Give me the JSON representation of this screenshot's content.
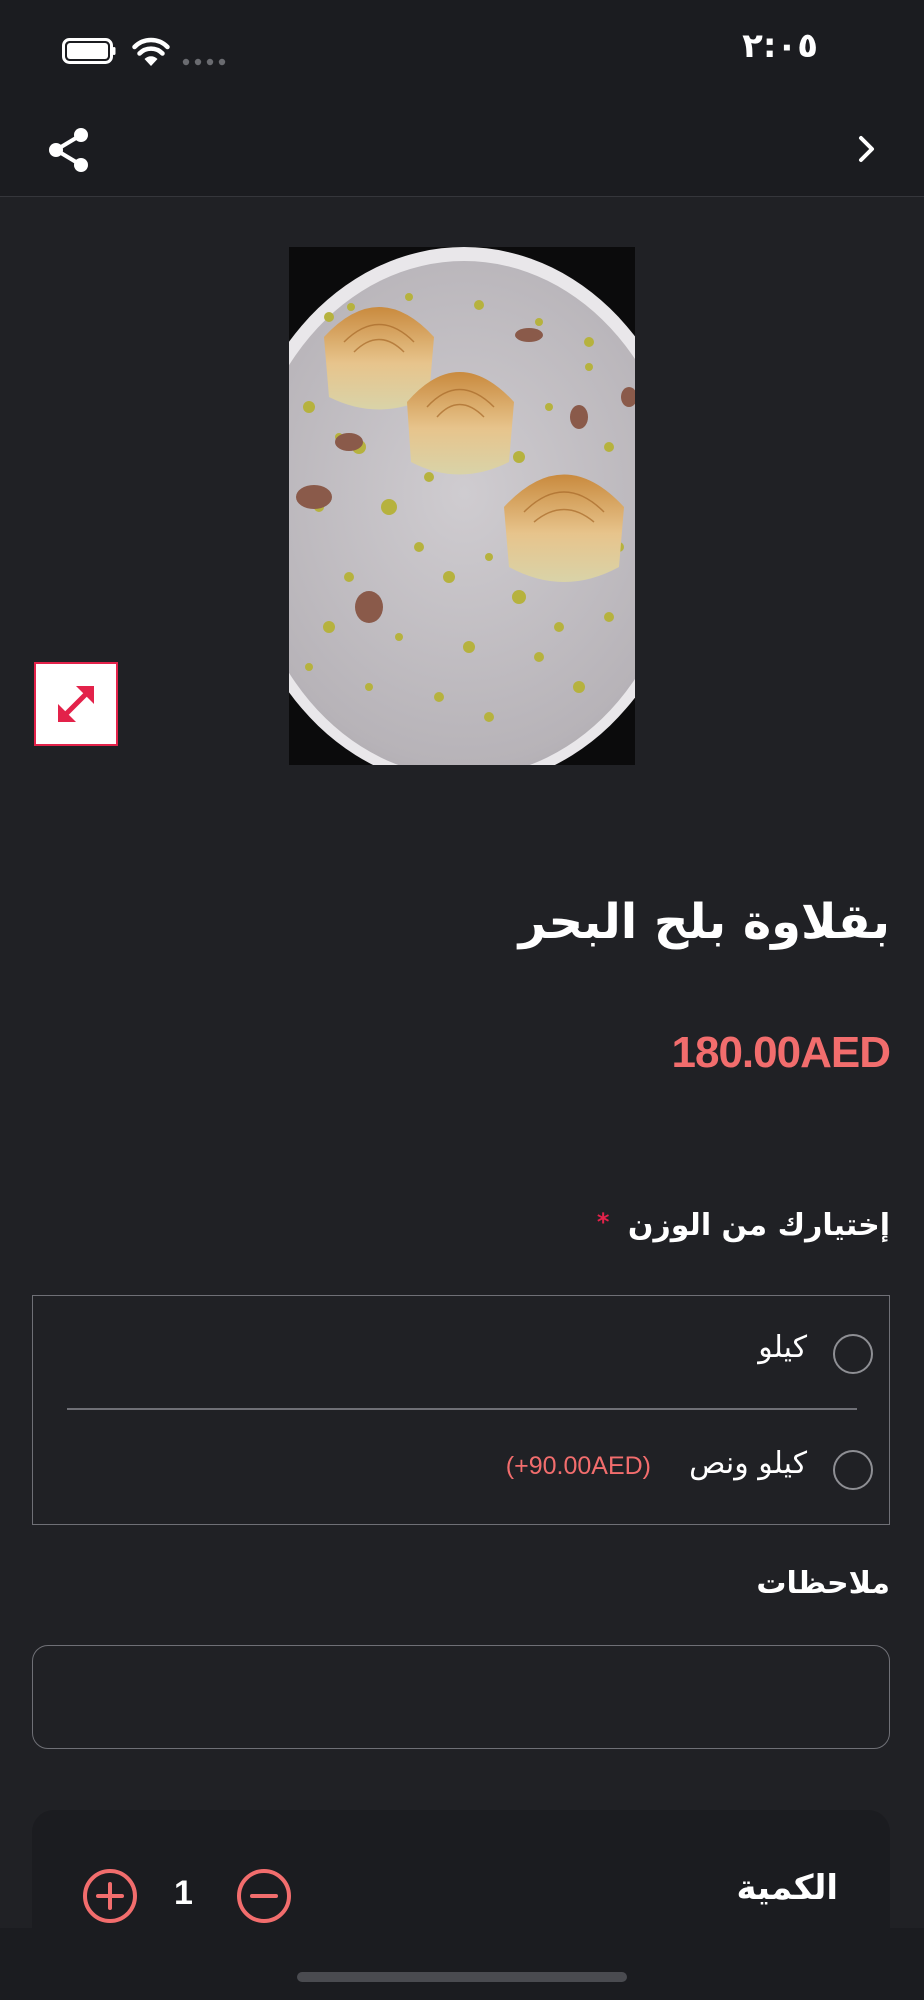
{
  "status_bar": {
    "time": "٢:٠٥"
  },
  "icons": {
    "share": "share-icon",
    "back": "chevron-right-icon",
    "expand": "expand-arrows-icon",
    "plus": "plus-circle-icon",
    "minus": "minus-circle-icon"
  },
  "product": {
    "title": "بقلاوة بلح البحر",
    "price": "180.00AED"
  },
  "weight_options": {
    "heading": "إختيارك من الوزن",
    "required_marker": "*",
    "options": [
      {
        "label": "كيلو",
        "extra": ""
      },
      {
        "label": "كيلو ونص",
        "extra": "(+90.00AED)"
      }
    ]
  },
  "notes": {
    "heading": "ملاحظات",
    "value": ""
  },
  "quantity": {
    "label": "الكمية",
    "value": "1"
  },
  "colors": {
    "accent": "#f26d6d",
    "expand_border": "#e3224a",
    "background": "#202125"
  }
}
